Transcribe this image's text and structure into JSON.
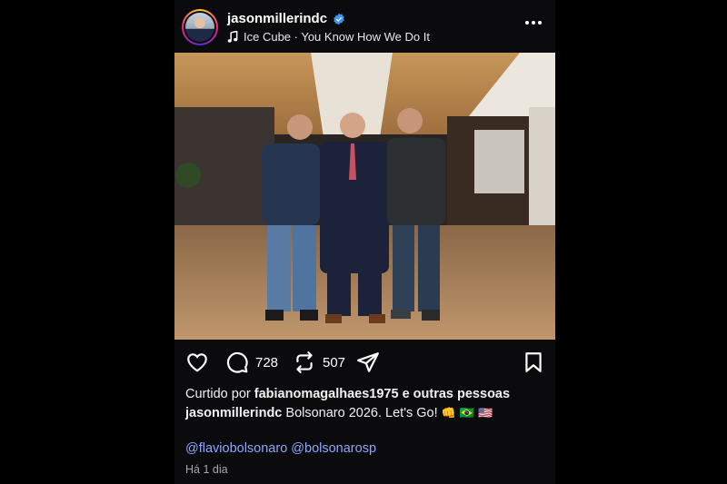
{
  "post": {
    "username": "jasonmillerindc",
    "music": "Ice Cube · You Know How We Do It",
    "comments": "728",
    "reposts": "507",
    "liked_prefix": "Curtido por",
    "liked_user": "fabianomagalhaes1975",
    "liked_suffix": "e outras pessoas",
    "caption_user": "jasonmillerindc",
    "caption_text": "Bolsonaro 2026. Let's Go!",
    "caption_emojis": [
      "👊",
      "🇧🇷",
      "🇺🇸"
    ],
    "mention_1": "@flaviobolsonaro",
    "mention_2": "@bolsonarosp",
    "time": "Há 1 dia"
  },
  "icons": {
    "verified": "verified-badge-icon",
    "music": "music-note-icon",
    "more": "more-options-icon",
    "like": "heart-icon",
    "comment": "comment-icon",
    "repost": "repost-icon",
    "share": "share-icon",
    "save": "bookmark-icon",
    "mute": "muted-speaker-icon"
  },
  "colors": {
    "background": "#0b0b0d",
    "verified": "#3897f0",
    "mention": "#8fa6ff"
  }
}
